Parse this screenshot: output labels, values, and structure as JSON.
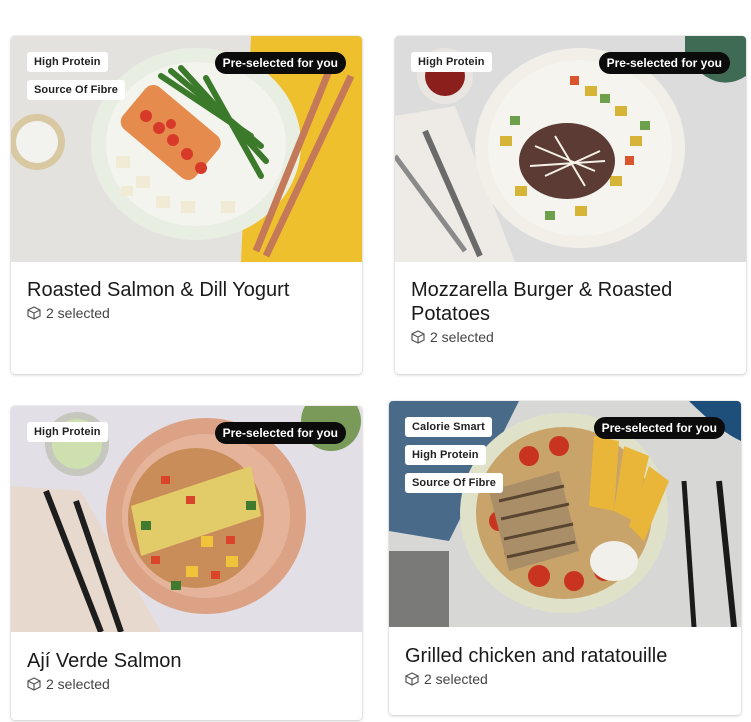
{
  "cards": [
    {
      "title": "Roasted Salmon & Dill Yogurt",
      "badges": [
        "High Protein",
        "Source Of Fibre"
      ],
      "preselected": "Pre-selected for you",
      "selected_text": "2 selected",
      "icon": "box-icon"
    },
    {
      "title": "Mozzarella Burger & Roasted Potatoes",
      "badges": [
        "High Protein"
      ],
      "preselected": "Pre-selected for you",
      "selected_text": "2 selected",
      "icon": "box-icon"
    },
    {
      "title": "Ají Verde Salmon",
      "badges": [
        "High Protein"
      ],
      "preselected": "Pre-selected for you",
      "selected_text": "2 selected",
      "icon": "box-icon"
    },
    {
      "title": "Grilled chicken and ratatouille",
      "badges": [
        "Calorie Smart",
        "High Protein",
        "Source Of Fibre"
      ],
      "preselected": "Pre-selected for you",
      "selected_text": "2 selected",
      "icon": "box-icon"
    }
  ],
  "colors": {
    "preselected_bg": "#0b0b0b",
    "badge_bg": "#ffffff"
  }
}
